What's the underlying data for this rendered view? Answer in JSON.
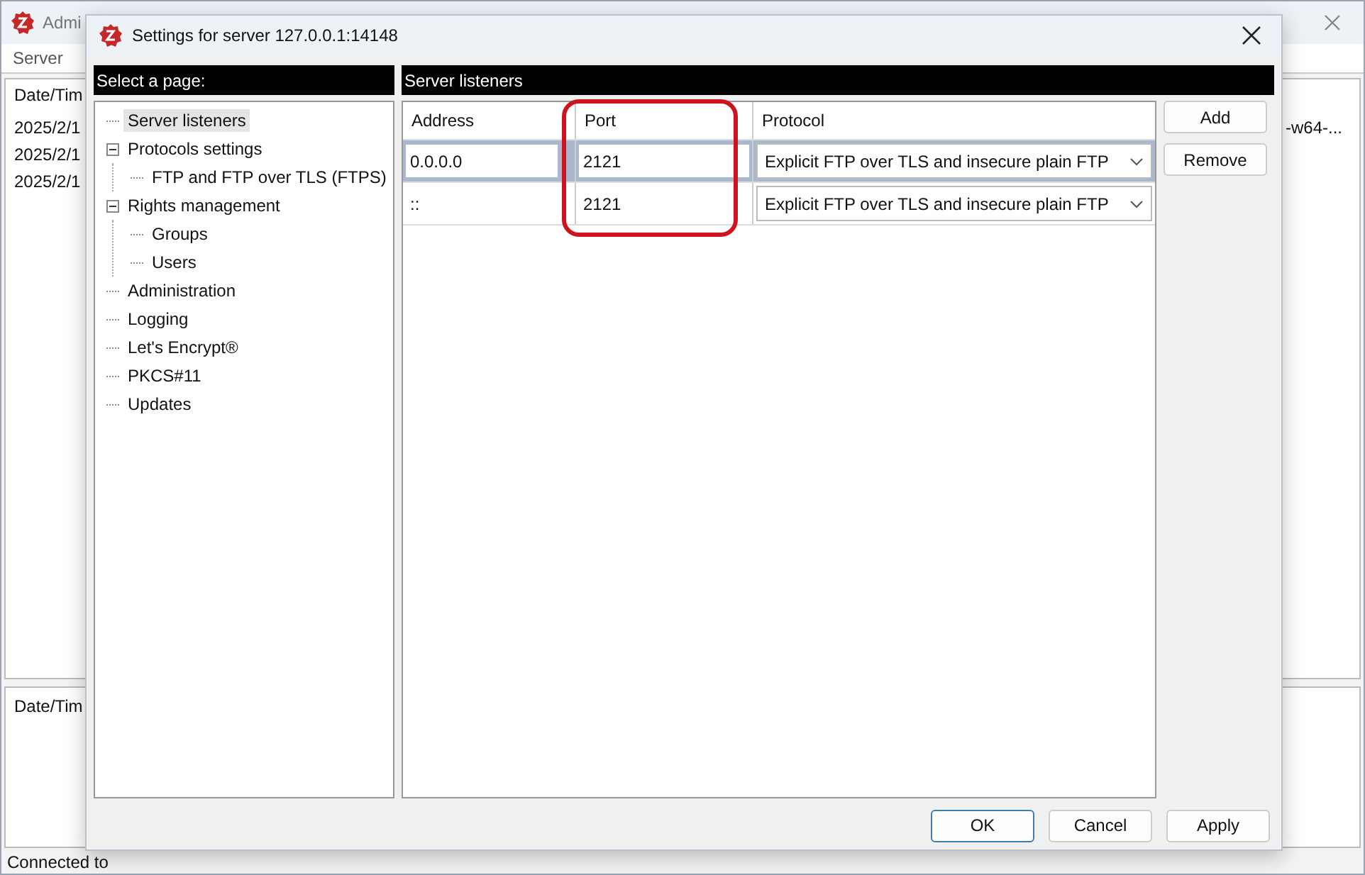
{
  "main_window": {
    "title": "Admi",
    "menu": [
      "Server"
    ],
    "log_header": "Date/Tim",
    "log_rows": [
      {
        "date": "2025/2/1",
        "text": "-w64-..."
      },
      {
        "date": "2025/2/1"
      },
      {
        "date": "2025/2/1"
      }
    ],
    "lower_header": "Date/Tim",
    "status_bar": "Connected to"
  },
  "dialog": {
    "title": "Settings for server 127.0.0.1:14148",
    "sidebar": {
      "heading": "Select a page:",
      "items": [
        {
          "label": "Server listeners",
          "selected": true
        },
        {
          "label": "Protocols settings",
          "selected": false,
          "expanded": true,
          "children": [
            {
              "label": "FTP and FTP over TLS (FTPS)",
              "selected": false
            }
          ]
        },
        {
          "label": "Rights management",
          "selected": false,
          "expanded": true,
          "children": [
            {
              "label": "Groups",
              "selected": false
            },
            {
              "label": "Users",
              "selected": false
            }
          ]
        },
        {
          "label": "Administration",
          "selected": false
        },
        {
          "label": "Logging",
          "selected": false
        },
        {
          "label": "Let's Encrypt®",
          "selected": false
        },
        {
          "label": "PKCS#11",
          "selected": false
        },
        {
          "label": "Updates",
          "selected": false
        }
      ]
    },
    "page_heading": "Server listeners",
    "table": {
      "columns": [
        "Address",
        "Port",
        "Protocol"
      ],
      "rows": [
        {
          "address": "0.0.0.0",
          "port": "2121",
          "protocol": "Explicit FTP over TLS and insecure plain FTP",
          "selected": true
        },
        {
          "address": "::",
          "port": "2121",
          "protocol": "Explicit FTP over TLS and insecure plain FTP",
          "selected": false
        }
      ]
    },
    "side_buttons": [
      "Add",
      "Remove"
    ],
    "buttons": [
      "OK",
      "Cancel",
      "Apply"
    ]
  }
}
